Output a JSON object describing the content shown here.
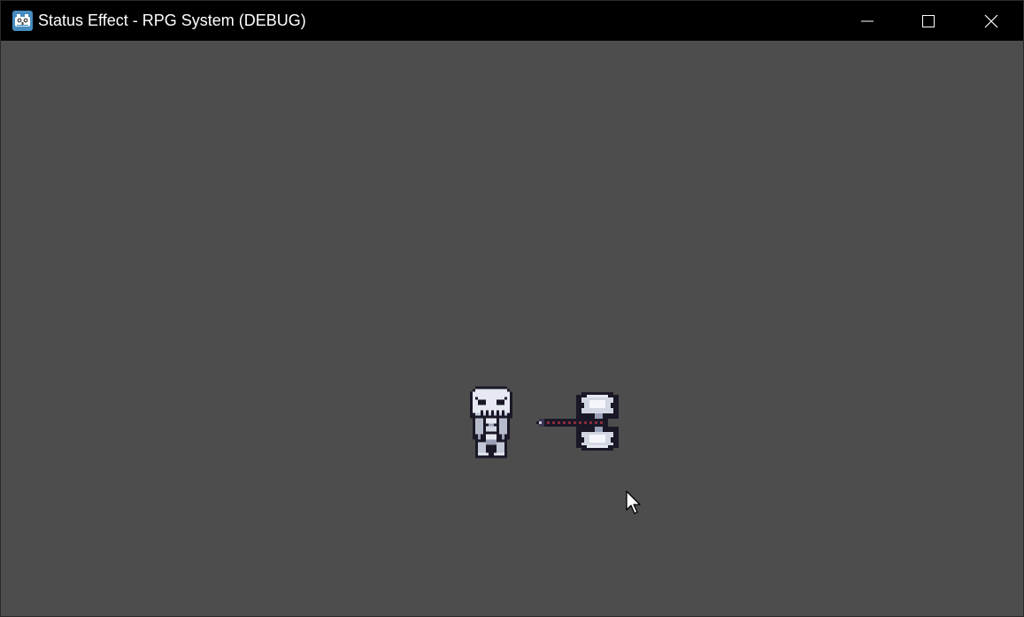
{
  "window": {
    "title": "Status Effect - RPG System (DEBUG)",
    "app_icon": "godot-engine-icon",
    "controls": {
      "minimize_icon": "minimize-icon",
      "maximize_icon": "maximize-icon",
      "close_icon": "close-icon"
    }
  },
  "game": {
    "background_color": "#4d4d4d",
    "sprites": [
      {
        "name": "skeleton-sprite",
        "description_icon": "skeleton-icon"
      },
      {
        "name": "double-axe-sprite",
        "description_icon": "double-axe-icon"
      }
    ],
    "cursor_icon": "mouse-pointer-icon"
  }
}
